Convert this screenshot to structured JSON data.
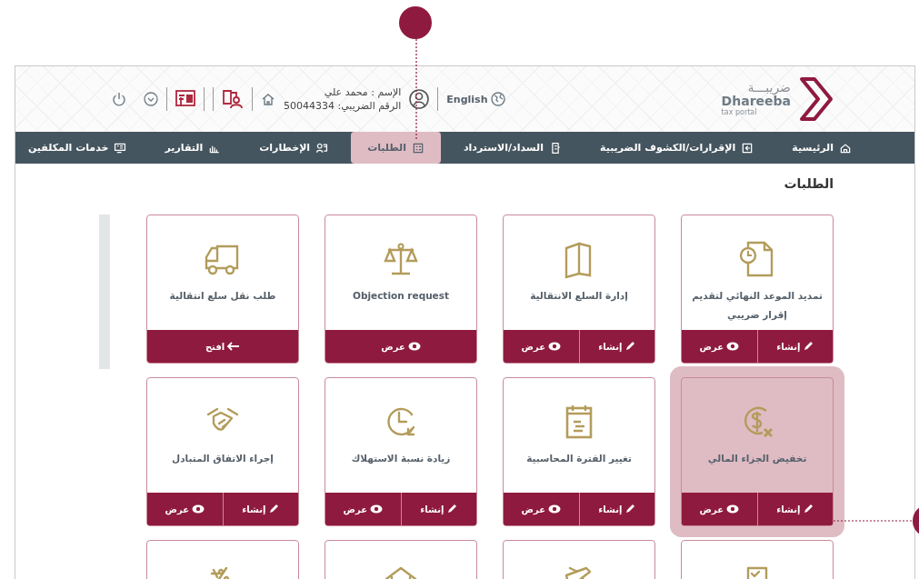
{
  "header": {
    "logo": {
      "arabic": "ضريبـــة",
      "name": "Dhareeba",
      "tagline": "tax portal"
    },
    "language": "English",
    "user": {
      "name": "الإسم : محمد علي",
      "tax_id": "الرقم الضريبي: 50044334"
    }
  },
  "nav": [
    {
      "label": "الرئيسية",
      "selected": false
    },
    {
      "label": "الإقرارات/الكشوف الضريبية",
      "selected": false
    },
    {
      "label": "السداد/الاسترداد",
      "selected": false
    },
    {
      "label": "الطلبات",
      "selected": true
    },
    {
      "label": "الإخطارات",
      "selected": false
    },
    {
      "label": "التقارير",
      "selected": false
    },
    {
      "label": "خدمات المكلفين",
      "selected": false
    }
  ],
  "page_title": "الطلبات",
  "cards": [
    {
      "kind": "full",
      "title": "تمديد الموعد النهائي لتقديم إقرار ضريبي",
      "selected": false,
      "actions": [
        {
          "kind": "create",
          "label": "إنشاء"
        },
        {
          "kind": "view",
          "label": "عرض"
        }
      ]
    },
    {
      "kind": "full",
      "title": "إدارة السلع الانتقالية",
      "selected": false,
      "actions": [
        {
          "kind": "create",
          "label": "إنشاء"
        },
        {
          "kind": "view",
          "label": "عرض"
        }
      ]
    },
    {
      "kind": "full",
      "title": "Objection request",
      "selected": false,
      "actions": [
        {
          "kind": "view",
          "label": "عرض"
        }
      ]
    },
    {
      "kind": "full",
      "title": "طلب نقل سلع انتقالية",
      "selected": false,
      "actions": [
        {
          "kind": "open",
          "label": "افتح"
        }
      ]
    },
    {
      "kind": "full",
      "title": "تخفيض الجزاء المالي",
      "selected": true,
      "actions": [
        {
          "kind": "create",
          "label": "إنشاء"
        },
        {
          "kind": "view",
          "label": "عرض"
        }
      ]
    },
    {
      "kind": "full",
      "title": "تغيير الفترة المحاسبية",
      "selected": false,
      "actions": [
        {
          "kind": "create",
          "label": "إنشاء"
        },
        {
          "kind": "view",
          "label": "عرض"
        }
      ]
    },
    {
      "kind": "full",
      "title": "زيادة نسبة الاستهلاك",
      "selected": false,
      "actions": [
        {
          "kind": "create",
          "label": "إنشاء"
        },
        {
          "kind": "view",
          "label": "عرض"
        }
      ]
    },
    {
      "kind": "full",
      "title": "إجراء الاتفاق المتبادل",
      "selected": false,
      "actions": [
        {
          "kind": "create",
          "label": "إنشاء"
        },
        {
          "kind": "view",
          "label": "عرض"
        }
      ]
    },
    {
      "kind": "partial",
      "selected": false
    },
    {
      "kind": "partial",
      "selected": false
    },
    {
      "kind": "partial",
      "selected": false
    },
    {
      "kind": "partial",
      "selected": false
    }
  ]
}
